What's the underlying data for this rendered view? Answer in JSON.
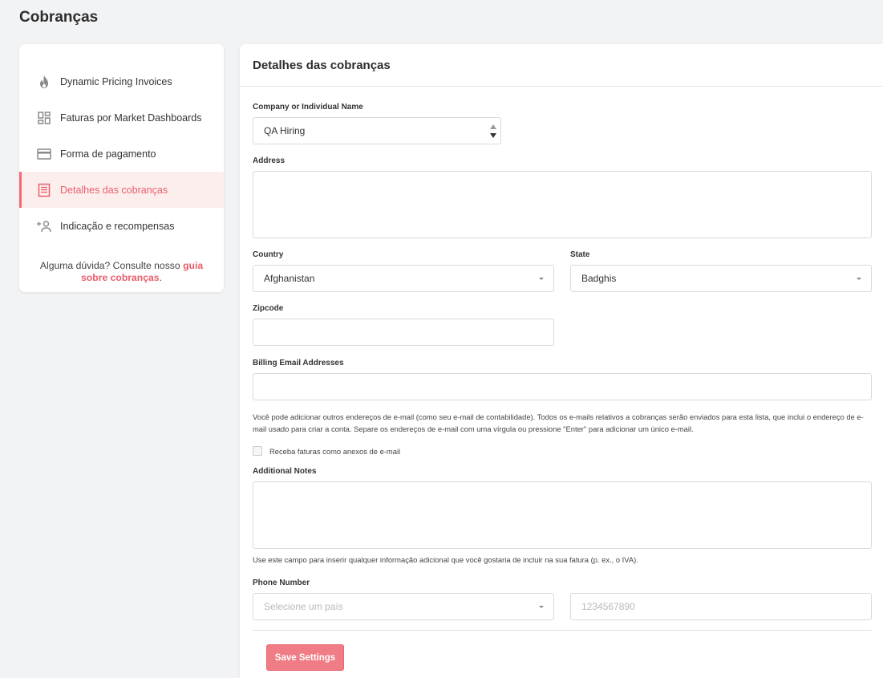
{
  "page_title": "Cobranças",
  "sidebar": {
    "items": [
      {
        "label": "Dynamic Pricing Invoices",
        "icon": "flame-icon"
      },
      {
        "label": "Faturas por Market Dashboards",
        "icon": "dashboard-grid-icon"
      },
      {
        "label": "Forma de pagamento",
        "icon": "credit-card-icon"
      },
      {
        "label": "Detalhes das cobranças",
        "icon": "receipt-icon",
        "active": true
      },
      {
        "label": "Indicação e recompensas",
        "icon": "add-user-icon"
      }
    ],
    "help_prefix": "Alguma dúvida? Consulte nosso ",
    "help_link": "guia sobre cobranças",
    "help_suffix": "."
  },
  "panel": {
    "title": "Detalhes das cobranças",
    "company": {
      "label": "Company or Individual Name",
      "value": "QA Hiring"
    },
    "address": {
      "label": "Address",
      "value": ""
    },
    "country": {
      "label": "Country",
      "value": "Afghanistan"
    },
    "state": {
      "label": "State",
      "value": "Badghis"
    },
    "zipcode": {
      "label": "Zipcode",
      "value": ""
    },
    "billing_email": {
      "label": "Billing Email Addresses",
      "value": "",
      "hint": "Você pode adicionar outros endereços de e-mail (como seu e-mail de contabilidade). Todos os e-mails relativos a cobranças serão enviados para esta lista, que inclui o endereço de e-mail usado para criar a conta. Separe os endereços de e-mail com uma vírgula ou pressione \"Enter\" para adicionar um único e-mail."
    },
    "attachments_checkbox": {
      "label": "Receba faturas como anexos de e-mail",
      "checked": false
    },
    "notes": {
      "label": "Additional Notes",
      "value": "",
      "hint": "Use este campo para inserir qualquer informação adicional que você gostaria de incluir na sua fatura (p. ex., o IVA)."
    },
    "phone": {
      "label": "Phone Number",
      "country_placeholder": "Selecione um país",
      "number_placeholder": "1234567890"
    },
    "save_label": "Save Settings"
  },
  "colors": {
    "accent": "#ef6b76",
    "button": "#f07c85",
    "background": "#f2f3f5"
  }
}
